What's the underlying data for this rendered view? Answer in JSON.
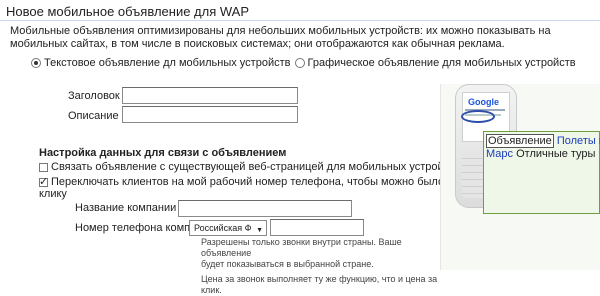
{
  "page": {
    "title": "Новое мобильное объявление для WAP",
    "description": "Мобильные объявления оптимизированы для небольших мобильных устройств: их можно показывать на мобильных сайтах, в том числе в поисковых системах; они отображаются как обычная реклама."
  },
  "ad_type": {
    "text_option": "Текстовое объявление дл мобильных устройств",
    "image_option": "Графическое объявление для мобильных устройств",
    "selected": "text"
  },
  "form": {
    "headline_label": "Заголовок",
    "headline_value": "",
    "description_label": "Описание",
    "description_value": ""
  },
  "contact": {
    "section_title": "Настройка данных для связи с объявлением",
    "link_webpage_label": "Связать объявление с существующей веб-страницей для мобильных устройств",
    "link_webpage_checked": false,
    "call_label_line1": "Переключать клиентов на мой рабочий номер телефона, чтобы можно было звонить по",
    "call_label_line2": "клику",
    "call_checked": true,
    "company_name_label": "Название компании",
    "company_name_value": "",
    "phone_label": "Номер телефона компании",
    "country_selected": "Российская Ф",
    "phone_value": "",
    "hint_line1": "Разрешены только звонки внутри страны. Ваше объявление",
    "hint_line2": "будет показываться в выбранной стране.",
    "hint_line3": "Цена за звонок выполняет ту же функцию, что и цена за клик."
  },
  "preview": {
    "brand": "Google",
    "ad_word": "Объявление",
    "link_text": "Полеты на",
    "line2_link": "Марс",
    "line2_text": "Отличные туры"
  },
  "icons": {
    "help": "question-mark-icon",
    "dropdown": "chevron-down-icon"
  },
  "colors": {
    "title_rule": "#c9d7f1",
    "link": "#1a3cbc",
    "preview_border": "#6d9f3f",
    "highlight": "#2d4da8"
  }
}
